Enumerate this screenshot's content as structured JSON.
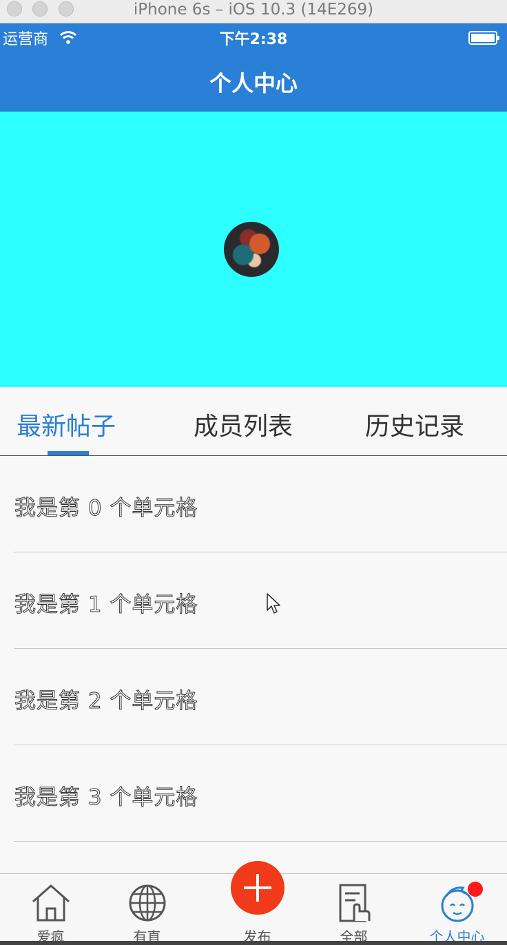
{
  "simulator": {
    "title": "iPhone 6s – iOS 10.3 (14E269)"
  },
  "status_bar": {
    "carrier": "运营商",
    "time": "下午2:38"
  },
  "nav": {
    "title": "个人中心"
  },
  "colors": {
    "accent": "#2a7fd6",
    "hero": "#2dfffe",
    "publish": "#f03a1a",
    "badge": "#ff1a1a"
  },
  "tabs": [
    {
      "label": "最新帖子",
      "active": true
    },
    {
      "label": "成员列表",
      "active": false
    },
    {
      "label": "历史记录",
      "active": false
    }
  ],
  "cells": [
    {
      "text": "我是第 0 个单元格"
    },
    {
      "text": "我是第 1 个单元格"
    },
    {
      "text": "我是第 2 个单元格"
    },
    {
      "text": "我是第 3 个单元格"
    }
  ],
  "tabbar": [
    {
      "label": "爱疯",
      "icon": "house-icon"
    },
    {
      "label": "有直",
      "icon": "globe-icon"
    },
    {
      "label": "发布",
      "icon": "plus-icon"
    },
    {
      "label": "全部",
      "icon": "document-icon"
    },
    {
      "label": "个人中心",
      "icon": "baby-face-icon",
      "active": true
    }
  ]
}
